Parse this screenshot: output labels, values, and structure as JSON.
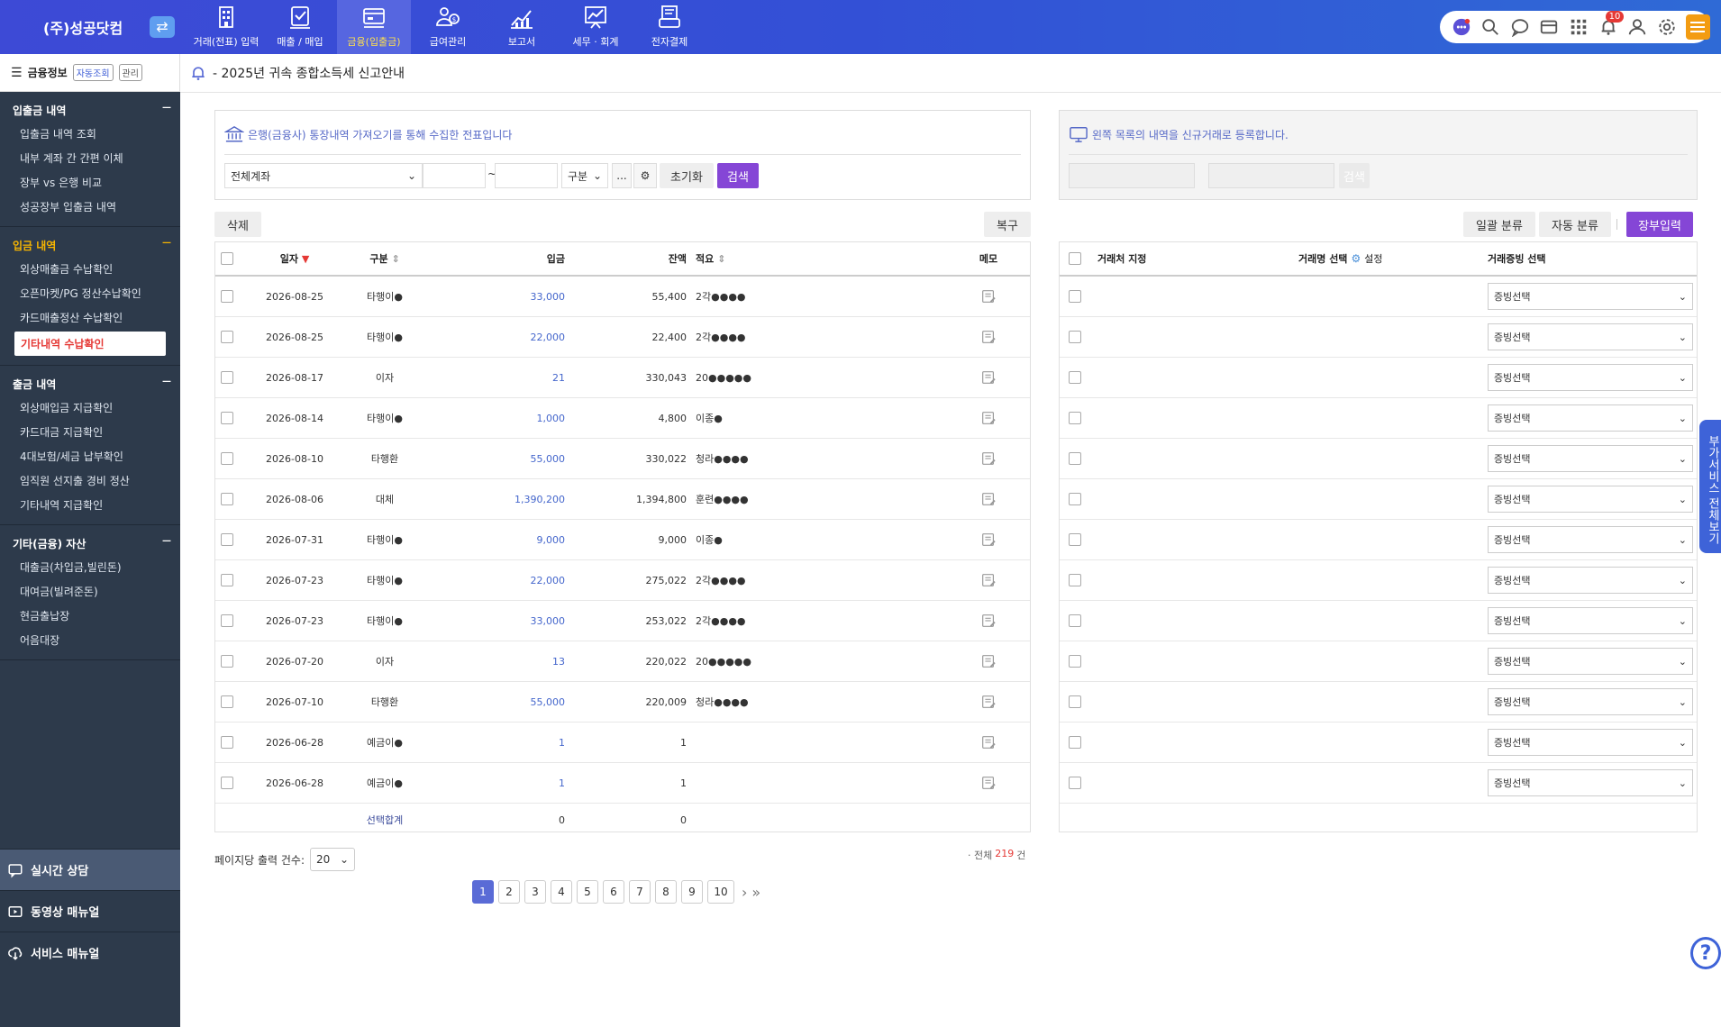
{
  "brand": {
    "name": "(주)성공닷컴"
  },
  "nav": [
    {
      "label": "거래(전표) 입력",
      "icon": "building-icon"
    },
    {
      "label": "매출 / 매입",
      "icon": "invoice-icon"
    },
    {
      "label": "금융(입출금)",
      "icon": "bank-card-icon",
      "active": true
    },
    {
      "label": "급여관리",
      "icon": "payroll-icon"
    },
    {
      "label": "보고서",
      "icon": "chart-report-icon"
    },
    {
      "label": "세무 · 회계",
      "icon": "tax-chart-icon"
    },
    {
      "label": "전자결제",
      "icon": "payment-icon"
    }
  ],
  "topright": {
    "notification_count": "10"
  },
  "sidebar": {
    "header": "금융정보",
    "btn_auto": "자동조회",
    "btn_manage": "관리",
    "sections": [
      {
        "title": "입출금 내역",
        "items": [
          "입출금 내역 조회",
          "내부 계좌 간 간편 이체",
          "장부 vs 은행 비교",
          "성공장부 입출금 내역"
        ]
      },
      {
        "title": "입금 내역",
        "items": [
          "외상매출금 수납확인",
          "오픈마켓/PG 정산수납확인",
          "카드매출정산 수납확인",
          "기타내역 수납확인"
        ]
      },
      {
        "title": "출금 내역",
        "items": [
          "외상매입금 지급확인",
          "카드대금 지급확인",
          "4대보험/세금 납부확인",
          "임직원 선지출 경비 정산",
          "기타내역 지급확인"
        ]
      },
      {
        "title": "기타(금융) 자산",
        "items": [
          "대출금(차입금,빌린돈)",
          "대여금(빌려준돈)",
          "현금출납장",
          "어음대장"
        ]
      }
    ],
    "bottom": [
      "실시간 상담",
      "동영상 매뉴얼",
      "서비스 매뉴얼"
    ]
  },
  "notice": "- 2025년 귀속 종합소득세 신고안내",
  "left_panel": {
    "desc": "은행(금융사) 통장내역 가져오기를 통해 수집한 전표입니다",
    "account": "전체계좌",
    "tilde": "~",
    "type": "구분",
    "ellipsis": "...",
    "reset": "초기화",
    "search": "검색",
    "delete": "삭제",
    "restore": "복구",
    "headers": {
      "date": "일자",
      "type": "구분",
      "deposit": "입금",
      "balance": "잔액",
      "memo_desc": "적요",
      "memo": "메모"
    },
    "rows": [
      {
        "date": "2026-08-25",
        "type": "타행이●",
        "deposit": "33,000",
        "balance": "55,400",
        "desc": "2각●●●●"
      },
      {
        "date": "2026-08-25",
        "type": "타행이●",
        "deposit": "22,000",
        "balance": "22,400",
        "desc": "2각●●●●"
      },
      {
        "date": "2026-08-17",
        "type": "이자",
        "deposit": "21",
        "balance": "330,043",
        "desc": "20●●●●●"
      },
      {
        "date": "2026-08-14",
        "type": "타행이●",
        "deposit": "1,000",
        "balance": "4,800",
        "desc": "이종●"
      },
      {
        "date": "2026-08-10",
        "type": "타행환",
        "deposit": "55,000",
        "balance": "330,022",
        "desc": "청라●●●●"
      },
      {
        "date": "2026-08-06",
        "type": "대체",
        "deposit": "1,390,200",
        "balance": "1,394,800",
        "desc": "훈련●●●●"
      },
      {
        "date": "2026-07-31",
        "type": "타행이●",
        "deposit": "9,000",
        "balance": "9,000",
        "desc": "이종●"
      },
      {
        "date": "2026-07-23",
        "type": "타행이●",
        "deposit": "22,000",
        "balance": "275,022",
        "desc": "2각●●●●"
      },
      {
        "date": "2026-07-23",
        "type": "타행이●",
        "deposit": "33,000",
        "balance": "253,022",
        "desc": "2각●●●●"
      },
      {
        "date": "2026-07-20",
        "type": "이자",
        "deposit": "13",
        "balance": "220,022",
        "desc": "20●●●●●"
      },
      {
        "date": "2026-07-10",
        "type": "타행환",
        "deposit": "55,000",
        "balance": "220,009",
        "desc": "청라●●●●"
      },
      {
        "date": "2026-06-28",
        "type": "예금이●",
        "deposit": "1",
        "balance": "1",
        "desc": ""
      },
      {
        "date": "2026-06-28",
        "type": "예금이●",
        "deposit": "1",
        "balance": "1",
        "desc": ""
      }
    ],
    "footer": {
      "label": "선택합계",
      "deposit": "0",
      "balance": "0"
    },
    "per_page_label": "페이지당 출력 건수:",
    "per_page": "20",
    "total_prefix": "· 전체",
    "total": "219",
    "total_suffix": "건"
  },
  "right_panel": {
    "desc": "왼쪽 목록의 내역을 신규거래로 등록합니다.",
    "search": "검색",
    "batch": "일괄 분류",
    "auto": "자동 분류",
    "ledger": "장부입력",
    "headers": {
      "partner": "거래처 지정",
      "item": "거래명 선택",
      "settings": "설정",
      "evidence": "거래증빙 선택"
    },
    "select_label": "증빙선택"
  },
  "pagination": [
    "1",
    "2",
    "3",
    "4",
    "5",
    "6",
    "7",
    "8",
    "9",
    "10"
  ],
  "side_tab": "부가서비스 전체보기",
  "help": "?"
}
